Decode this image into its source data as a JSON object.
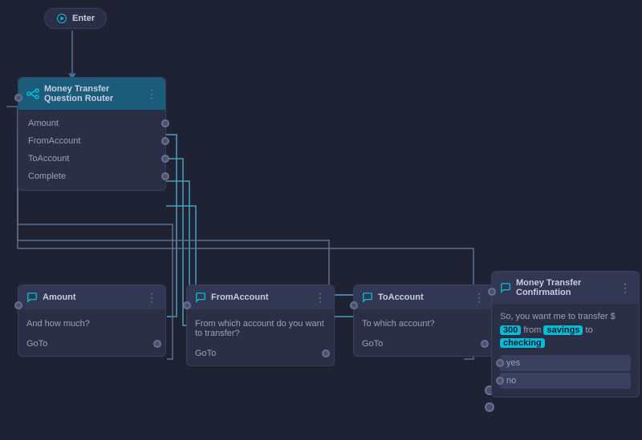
{
  "enter": {
    "label": "Enter"
  },
  "router": {
    "title": "Money Transfer Question Router",
    "icon": "router-icon",
    "slots": [
      {
        "label": "Amount"
      },
      {
        "label": "FromAccount"
      },
      {
        "label": "ToAccount"
      },
      {
        "label": "Complete"
      }
    ]
  },
  "amount_node": {
    "title": "Amount",
    "question": "And how much?",
    "goto": "GoTo"
  },
  "from_account_node": {
    "title": "FromAccount",
    "question": "From which account do you want to transfer?",
    "goto": "GoTo"
  },
  "to_account_node": {
    "title": "ToAccount",
    "question": "To which account?",
    "goto": "GoTo"
  },
  "confirm_node": {
    "title": "Money Transfer Confirmation",
    "text_prefix": "So, you want me to transfer $",
    "amount": "300",
    "text_middle": "from",
    "from_account": "savings",
    "text_to": "to",
    "to_account": "checking",
    "options": [
      "yes",
      "no"
    ]
  },
  "colors": {
    "accent": "#00bcd4",
    "node_bg": "#2a2f45",
    "node_header": "#323753",
    "router_header": "#1a5c7a",
    "port": "#6a7090",
    "connection": "#4a9ebb",
    "text": "#9aa0be"
  }
}
